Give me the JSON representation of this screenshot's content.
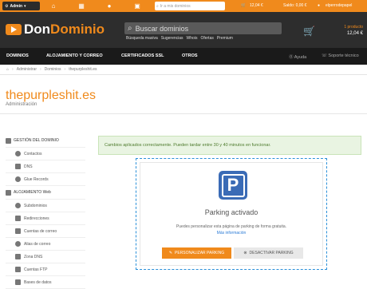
{
  "topbar": {
    "admin_label": "Admin",
    "search_placeholder": "Ir a mis dominios",
    "cart_amount": "12,04 €",
    "balance": "Saldo: 0,00 €",
    "user": "elperrodepapel"
  },
  "header": {
    "logo_part1": "Don",
    "logo_part2": "Dominio",
    "search_placeholder": "Buscar dominios",
    "search_links": [
      "Búsqueda masiva",
      "Sugerencias",
      "Whois",
      "Ofertas",
      "Premium"
    ],
    "cart_count": "1 producto",
    "cart_total": "12,04 €"
  },
  "nav": {
    "items": [
      "DOMINIOS",
      "ALOJAMIENTO Y CORREO",
      "CERTIFICADOS SSL",
      "OTROS"
    ],
    "help": "Ayuda",
    "support": "Soporte técnico"
  },
  "breadcrumb": [
    "Administrar",
    "Dominios",
    "thepurpleshit.es"
  ],
  "page": {
    "domain": "thepurpleshit.es",
    "subtitle": "Administración"
  },
  "sidebar": {
    "section1": "GESTIÓN DEL DOMINIO",
    "group1": [
      "Contactos",
      "DNS",
      "Glue Records"
    ],
    "section2": "ALOJAMIENTO Web",
    "group2": [
      "Subdominios",
      "Redirecciones",
      "Cuentas de correo",
      "Alias de correo",
      "Zona DNS",
      "Cuentas FTP",
      "Bases de datos"
    ]
  },
  "alert": "Cambios aplicados correctamente. Pueden tardar entre 30 y 40 minutos en funcionar.",
  "parking": {
    "icon_letter": "P",
    "title": "Parking activado",
    "description": "Puedes personalizar esta página de parking de forma gratuita.",
    "link": "Más información",
    "customize_button": "PERSONALIZAR PARKING",
    "deactivate_button": "DESACTIVAR PARKING"
  },
  "colors": {
    "accent": "#f08a1c",
    "header_bg": "#2d2d2d",
    "nav_bg": "#1a1a1a",
    "success_bg": "#e9f4e2",
    "parking_icon": "#3a6bb6"
  }
}
